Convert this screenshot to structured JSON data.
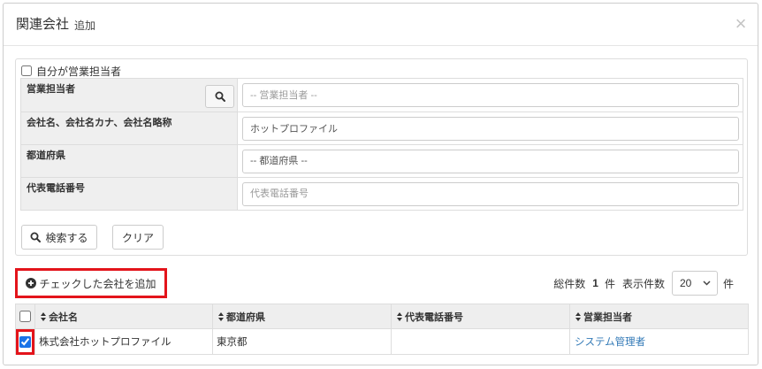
{
  "modal": {
    "title": "関連会社",
    "subtitle": "追加",
    "close": "×"
  },
  "filter": {
    "self_sales_rep": {
      "label": "自分が営業担当者",
      "checked": false
    },
    "sales_rep": {
      "label": "営業担当者",
      "placeholder": "-- 営業担当者 --"
    },
    "company": {
      "label": "会社名、会社名カナ、会社名略称",
      "value": "ホットプロファイル"
    },
    "prefecture": {
      "label": "都道府県",
      "selected": "-- 都道府県 --"
    },
    "phone": {
      "label": "代表電話番号",
      "placeholder": "代表電話番号"
    },
    "search_button": "検索する",
    "clear_button": "クリア"
  },
  "results": {
    "add_checked_button": "チェックした会社を追加",
    "total_label": "総件数",
    "total_count": "1",
    "total_unit": "件",
    "page_size_label": "表示件数",
    "page_size": "20",
    "page_size_unit": "件",
    "select_all_checked": false,
    "columns": [
      "会社名",
      "都道府県",
      "代表電話番号",
      "営業担当者"
    ],
    "rows": [
      {
        "checked": true,
        "company": "株式会社ホットプロファイル",
        "prefecture": "東京都",
        "phone": "",
        "sales_rep": "システム管理者"
      }
    ]
  },
  "icons": {
    "close": "close-icon",
    "sales_rep_search": "search-icon",
    "search_button": "search-icon",
    "add_checked": "plus-circle-icon",
    "column_sort": "sort-icon",
    "page_size_dropdown": "chevron-down-icon"
  },
  "colors": {
    "highlight": "#e3141b",
    "link": "#337ab7",
    "checkbox": "#1a73e8",
    "label_background": "#efefef",
    "header_background": "#eeeeee",
    "border": "#dddddd"
  }
}
